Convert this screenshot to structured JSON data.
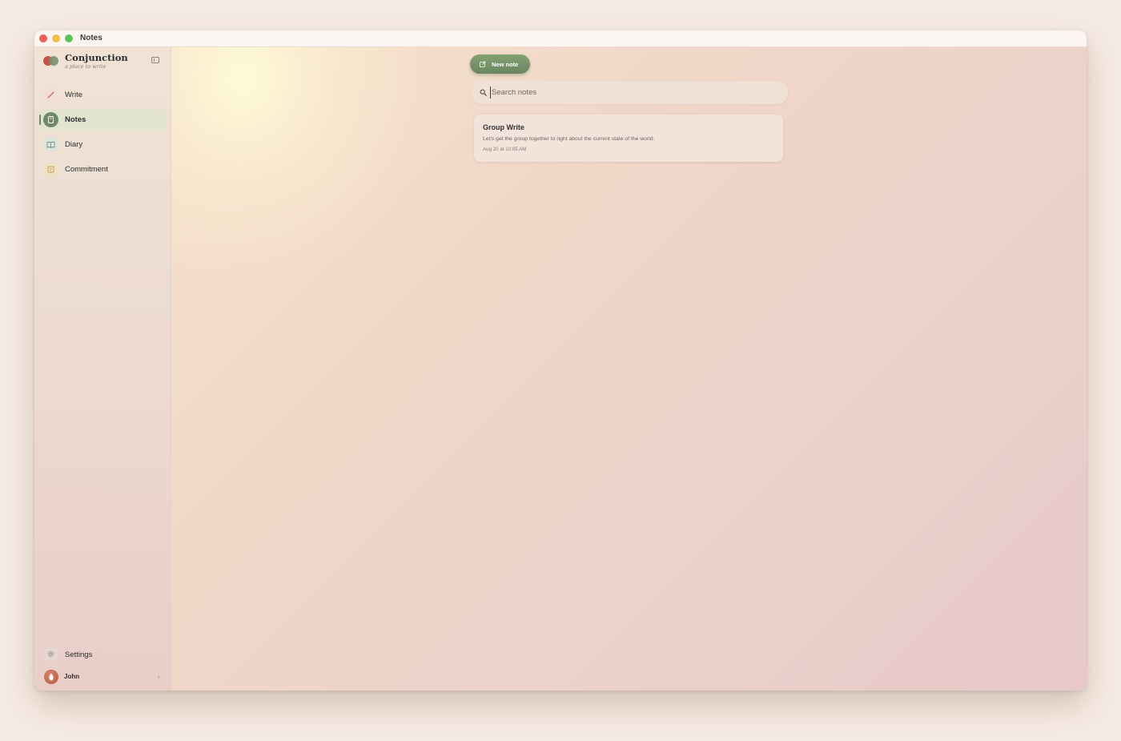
{
  "window": {
    "title": "Notes"
  },
  "sidebar": {
    "brand_name": "Conjunction",
    "brand_tagline": "a place to write",
    "items": [
      {
        "label": "Write",
        "icon": "pencil-icon",
        "active": false
      },
      {
        "label": "Notes",
        "icon": "notebook-icon",
        "active": true
      },
      {
        "label": "Diary",
        "icon": "book-icon",
        "active": false
      },
      {
        "label": "Commitment",
        "icon": "calendar-icon",
        "active": false
      }
    ],
    "settings_label": "Settings",
    "user": {
      "name": "John"
    }
  },
  "main": {
    "new_note_label": "New note",
    "search": {
      "placeholder": "Search notes",
      "value": ""
    },
    "notes": [
      {
        "title": "Group Write",
        "snippet": "Let's get the group together to right about the current state of the world.",
        "date": "Aug 20 at 10:05 AM"
      }
    ]
  },
  "colors": {
    "accent": "#6e8963",
    "brand_red": "#c2554a",
    "brand_green": "#7d946f"
  }
}
